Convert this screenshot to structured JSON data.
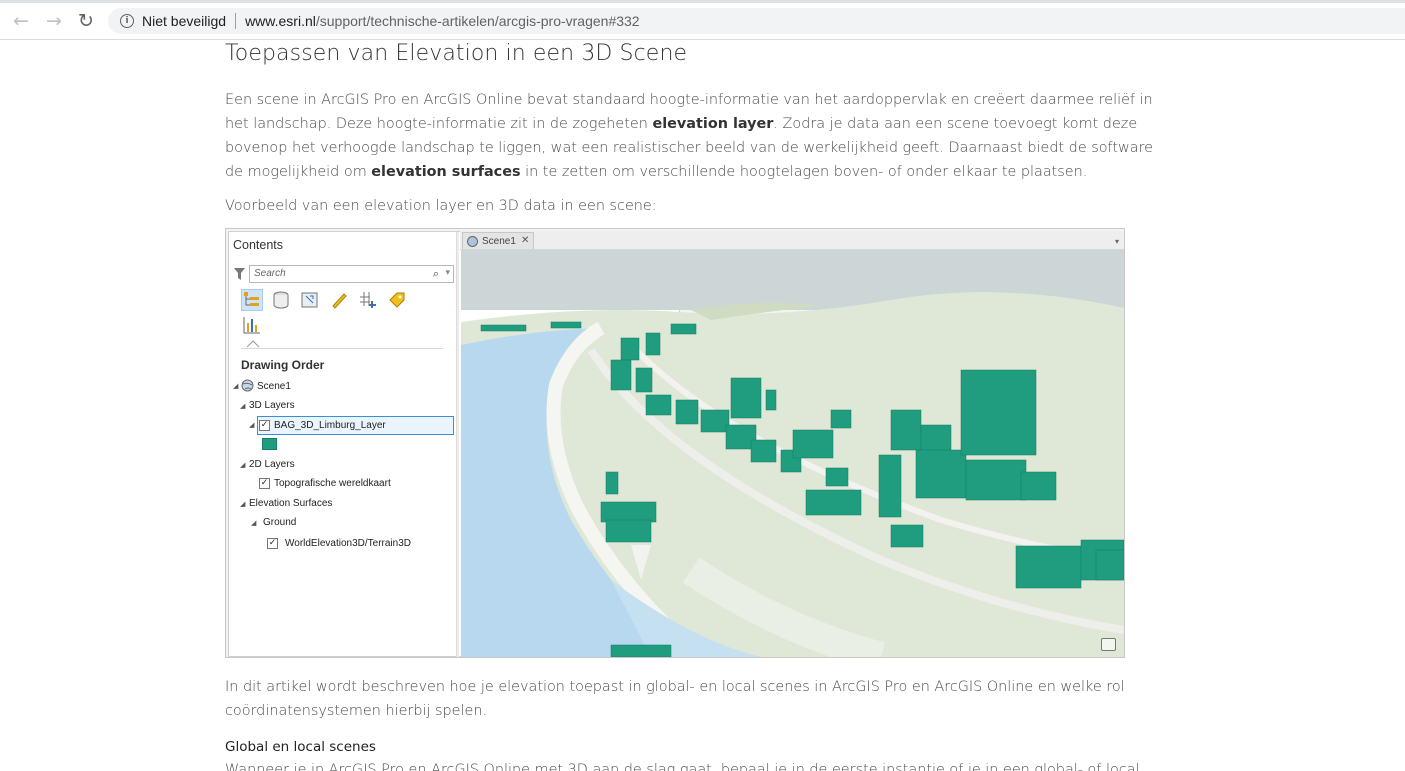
{
  "browser": {
    "security_label": "Niet beveiligd",
    "url_host": "www.esri.nl",
    "url_path": "/support/technische-artikelen/arcgis-pro-vragen#332",
    "back_icon": "arrow-left-icon",
    "forward_icon": "arrow-right-icon",
    "reload_icon": "reload-icon"
  },
  "article": {
    "title": "Toepassen van Elevation in een 3D Scene",
    "intro_1": "Een scene in ArcGIS Pro en ArcGIS Online bevat standaard hoogte-informatie van het aardoppervlak en creëert daarmee reliëf in het landschap. Deze hoogte-informatie zit in de zogeheten ",
    "intro_bold_1": "elevation layer",
    "intro_2": ". Zodra je data aan een scene toevoegt komt deze bovenop het verhoogde landschap te liggen, wat een realistischer beeld van de werkelijkheid geeft. Daarnaast biedt de software de mogelijkheid om ",
    "intro_bold_2": "elevation surfaces",
    "intro_3": " in te zetten om verschillende hoogtelagen boven- of onder elkaar te plaatsen.",
    "example_caption": "Voorbeeld van een elevation layer en 3D data in een scene:",
    "after_figure": "In dit artikel wordt beschreven hoe je elevation toepast in global- en local scenes in ArcGIS Pro en ArcGIS Online en welke rol coördinatensystemen hierbij spelen.",
    "section_heading": "Global en local scenes",
    "section_text_partial": "Wanneer je in ArcGIS Pro en ArcGIS Online met 3D aan de slag gaat, bepaal je in de eerste instantie of je in een global- of local"
  },
  "figure": {
    "contents_title": "Contents",
    "search_placeholder": "Search",
    "drawing_order": "Drawing Order",
    "scene_name": "Scene1",
    "group_3d": "3D Layers",
    "layer_3d": "BAG_3D_Limburg_Layer",
    "group_2d": "2D Layers",
    "layer_2d": "Topografische wereldkaart",
    "group_elev": "Elevation Surfaces",
    "ground": "Ground",
    "elev_source": "WorldElevation3D/Terrain3D",
    "scene_tab": "Scene1",
    "building_color": "#1f9d7e",
    "water_color": "#b7d8ee",
    "sky_color": "#cfd8d8"
  }
}
